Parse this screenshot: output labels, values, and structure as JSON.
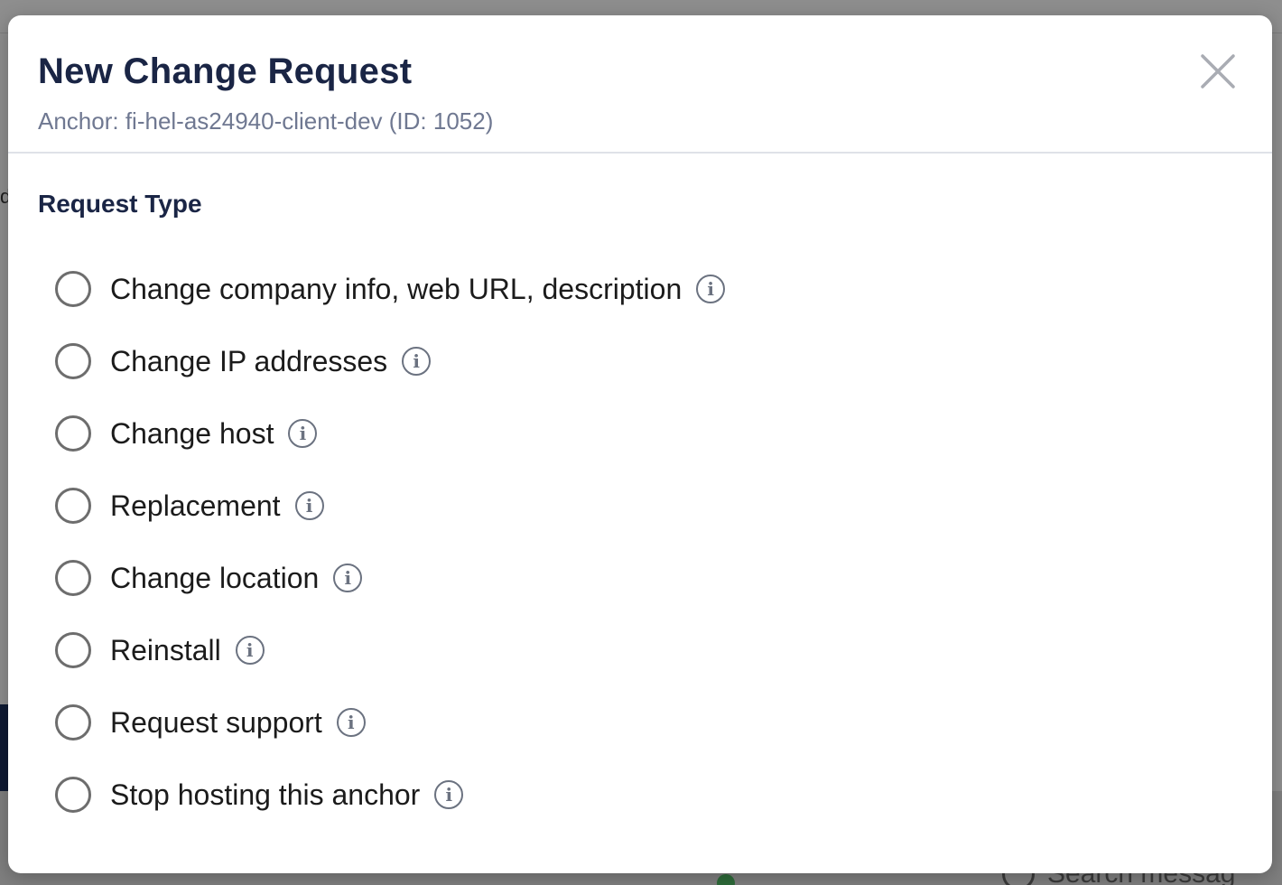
{
  "modal": {
    "title": "New Change Request",
    "subtitle": "Anchor: fi-hel-as24940-client-dev (ID: 1052)",
    "close_icon": "close-icon",
    "section_label": "Request Type",
    "options": [
      {
        "label": "Change company info, web URL, description",
        "info_icon": "i"
      },
      {
        "label": "Change IP addresses",
        "info_icon": "i"
      },
      {
        "label": "Change host",
        "info_icon": "i"
      },
      {
        "label": "Replacement",
        "info_icon": "i"
      },
      {
        "label": "Change location",
        "info_icon": "i"
      },
      {
        "label": "Reinstall",
        "info_icon": "i"
      },
      {
        "label": "Request support",
        "info_icon": "i"
      },
      {
        "label": "Stop hosting this anchor",
        "info_icon": "i"
      }
    ]
  },
  "background": {
    "fragment": "d",
    "search_placeholder": "Search messag"
  },
  "colors": {
    "title": "#1a2545",
    "subtitle": "#6f7891",
    "overlay": "#8e8e8e"
  }
}
